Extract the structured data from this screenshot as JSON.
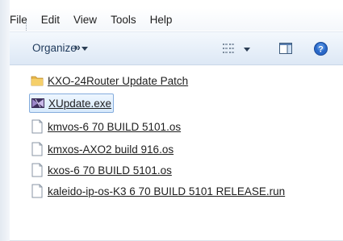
{
  "menubar": {
    "items": [
      {
        "label": "File"
      },
      {
        "label": "Edit"
      },
      {
        "label": "View"
      },
      {
        "label": "Tools"
      },
      {
        "label": "Help"
      }
    ]
  },
  "toolbar": {
    "organize_label": "Organize",
    "more_label": "»",
    "views_icon": "views-grid-icon",
    "preview_pane_icon": "preview-pane-icon",
    "help_icon": "help-icon"
  },
  "files": [
    {
      "name": "KXO-24Router Update Patch",
      "icon": "folder-icon",
      "selected": false
    },
    {
      "name": "XUpdate.exe",
      "icon": "exe-app-icon",
      "selected": true
    },
    {
      "name": "kmvos-6 70 BUILD 5101.os",
      "icon": "file-icon",
      "selected": false
    },
    {
      "name": "kmxos-AXO2 build 916.os",
      "icon": "file-icon",
      "selected": false
    },
    {
      "name": "kxos-6 70 BUILD 5101.os",
      "icon": "file-icon",
      "selected": false
    },
    {
      "name": "kaleido-ip-os-K3 6 70 BUILD 5101 RELEASE.run",
      "icon": "file-icon",
      "selected": false
    }
  ],
  "colors": {
    "folder": "#e8b84a",
    "selection_border": "#84acdd",
    "help_blue": "#2a68c8"
  }
}
